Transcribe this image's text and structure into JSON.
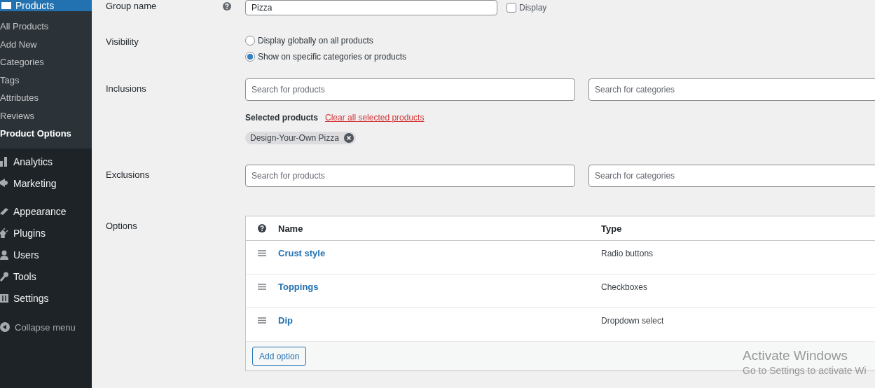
{
  "sidebar": {
    "header": "Products",
    "submenu": [
      {
        "label": "All Products",
        "selected": false
      },
      {
        "label": "Add New",
        "selected": false
      },
      {
        "label": "Categories",
        "selected": false
      },
      {
        "label": "Tags",
        "selected": false
      },
      {
        "label": "Attributes",
        "selected": false
      },
      {
        "label": "Reviews",
        "selected": false
      },
      {
        "label": "Product Options",
        "selected": true
      }
    ],
    "menu": [
      {
        "label": "Analytics"
      },
      {
        "label": "Marketing"
      },
      {
        "label": "Appearance"
      },
      {
        "label": "Plugins"
      },
      {
        "label": "Users"
      },
      {
        "label": "Tools"
      },
      {
        "label": "Settings"
      }
    ],
    "collapse": "Collapse menu"
  },
  "form": {
    "group_name": {
      "label": "Group name",
      "value": "Pizza",
      "checkbox": {
        "label": "Display",
        "checked": false
      }
    },
    "visibility": {
      "label": "Visibility",
      "options": [
        {
          "label": "Display globally on all products",
          "selected": false
        },
        {
          "label": "Show on specific categories or products",
          "selected": true
        }
      ]
    },
    "inclusions": {
      "label": "Inclusions",
      "fields": [
        {
          "placeholder": "Search for products"
        },
        {
          "placeholder": "Search for categories"
        }
      ],
      "selected_label": "Selected products",
      "clear_link": "Clear all selected products",
      "chips": [
        "Design-Your-Own Pizza"
      ]
    },
    "exclusions": {
      "label": "Exclusions",
      "fields": [
        {
          "placeholder": "Search for products"
        },
        {
          "placeholder": "Search for categories"
        }
      ]
    },
    "options": {
      "label": "Options",
      "columns": [
        "Name",
        "Type"
      ],
      "rows": [
        {
          "name": "Crust style",
          "type": "Radio buttons"
        },
        {
          "name": "Toppings",
          "type": "Checkboxes"
        },
        {
          "name": "Dip",
          "type": "Dropdown select"
        }
      ],
      "add_button": "Add option"
    }
  },
  "os_watermark": {
    "title": "Activate Windows",
    "subtitle": "Go to Settings to activate Wi"
  }
}
